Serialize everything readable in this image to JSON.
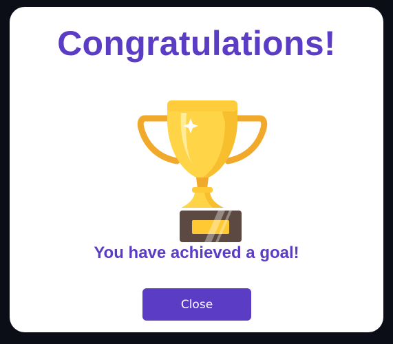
{
  "dialog": {
    "title": "Congratulations!",
    "message": "You have achieved a goal!",
    "close_label": "Close",
    "trophy_icon": "trophy-icon"
  },
  "colors": {
    "background": "#0b0e17",
    "card": "#ffffff",
    "accent": "#5b3cc4",
    "gold": "#ffd447",
    "gold_dark": "#f5a623",
    "base": "#5c4a42"
  }
}
